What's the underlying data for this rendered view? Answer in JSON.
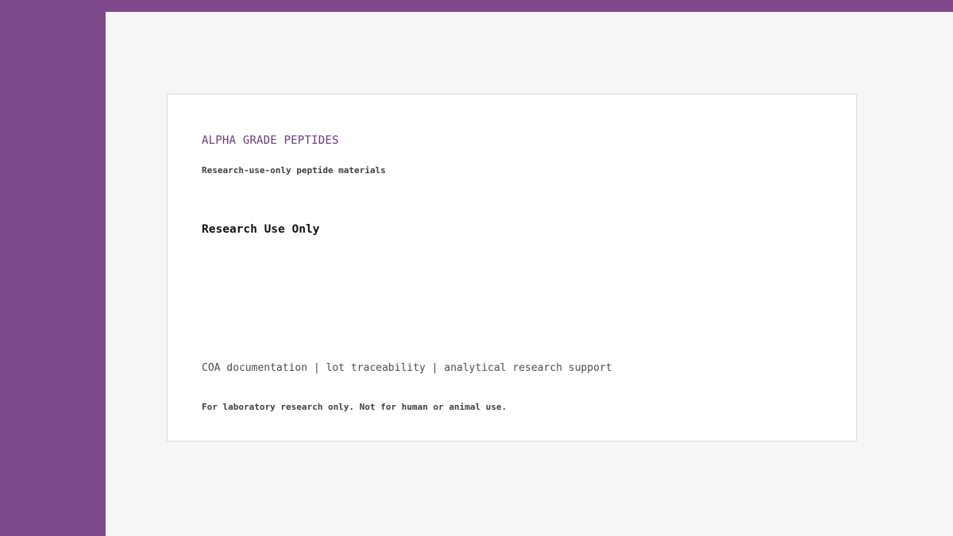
{
  "brand": {
    "name": "ALPHA GRADE PEPTIDES",
    "tagline": "Research-use-only peptide materials"
  },
  "main": {
    "heading": "Research Use Only",
    "features": "COA documentation | lot traceability | analytical research support",
    "disclaimer": "For laboratory research only. Not for human or animal use."
  },
  "colors": {
    "accent": "#7e4a8c",
    "brand_text": "#6a3a78",
    "page_background": "#f5f6f5",
    "card_background": "#ffffff"
  }
}
